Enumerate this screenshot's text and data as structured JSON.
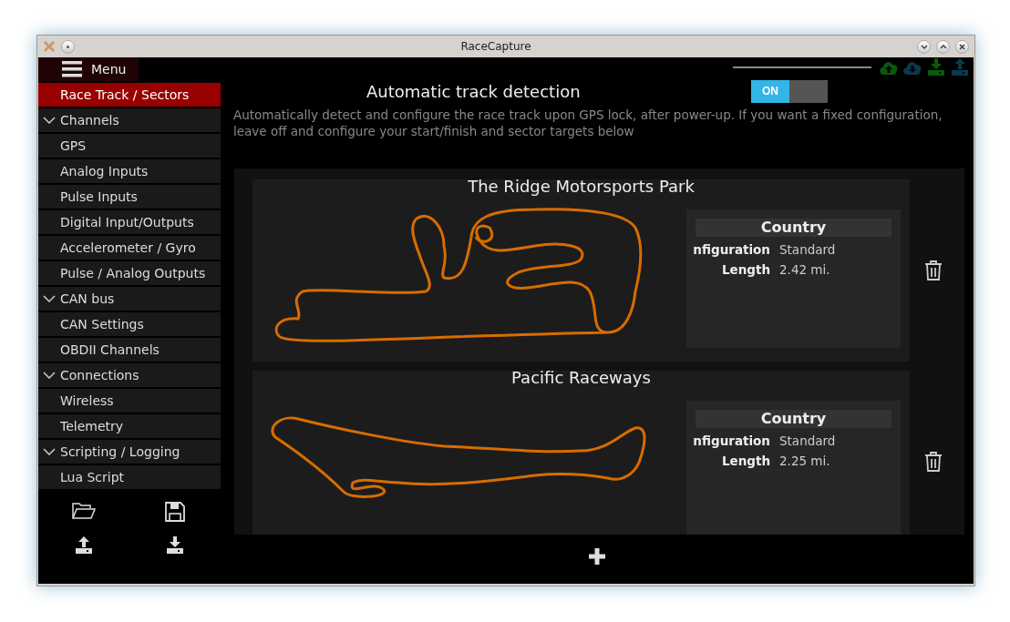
{
  "window": {
    "title": "RaceCapture"
  },
  "sidebar": {
    "menu_label": "Menu",
    "items": [
      {
        "label": "Race Track / Sectors",
        "kind": "page",
        "selected": true
      },
      {
        "label": "Channels",
        "kind": "section",
        "selected": false
      },
      {
        "label": "GPS",
        "kind": "page",
        "selected": false
      },
      {
        "label": "Analog Inputs",
        "kind": "page",
        "selected": false
      },
      {
        "label": "Pulse Inputs",
        "kind": "page",
        "selected": false
      },
      {
        "label": "Digital Input/Outputs",
        "kind": "page",
        "selected": false
      },
      {
        "label": "Accelerometer / Gyro",
        "kind": "page",
        "selected": false
      },
      {
        "label": "Pulse / Analog Outputs",
        "kind": "page",
        "selected": false
      },
      {
        "label": "CAN bus",
        "kind": "section",
        "selected": false
      },
      {
        "label": "CAN Settings",
        "kind": "page",
        "selected": false
      },
      {
        "label": "OBDII Channels",
        "kind": "page",
        "selected": false
      },
      {
        "label": "Connections",
        "kind": "section",
        "selected": false
      },
      {
        "label": "Wireless",
        "kind": "page",
        "selected": false
      },
      {
        "label": "Telemetry",
        "kind": "page",
        "selected": false
      },
      {
        "label": "Scripting / Logging",
        "kind": "section",
        "selected": false
      },
      {
        "label": "Lua Script",
        "kind": "page",
        "selected": false
      }
    ]
  },
  "auto_detect": {
    "title": "Automatic track detection",
    "toggle": {
      "label": "ON",
      "on": true
    },
    "description": "Automatically detect and configure the race track upon GPS lock, after power-up. If you want a fixed configuration, leave off and configure your start/finish and sector targets below"
  },
  "tracks": [
    {
      "name": "The Ridge Motorsports Park",
      "country": "Country",
      "fields": [
        {
          "label": "nfiguration",
          "value": "Standard"
        },
        {
          "label": "Length",
          "value": "2.42 mi."
        }
      ]
    },
    {
      "name": "Pacific Raceways",
      "country": "Country",
      "fields": [
        {
          "label": "nfiguration",
          "value": "Standard"
        },
        {
          "label": "Length",
          "value": "2.25 mi."
        }
      ]
    }
  ]
}
